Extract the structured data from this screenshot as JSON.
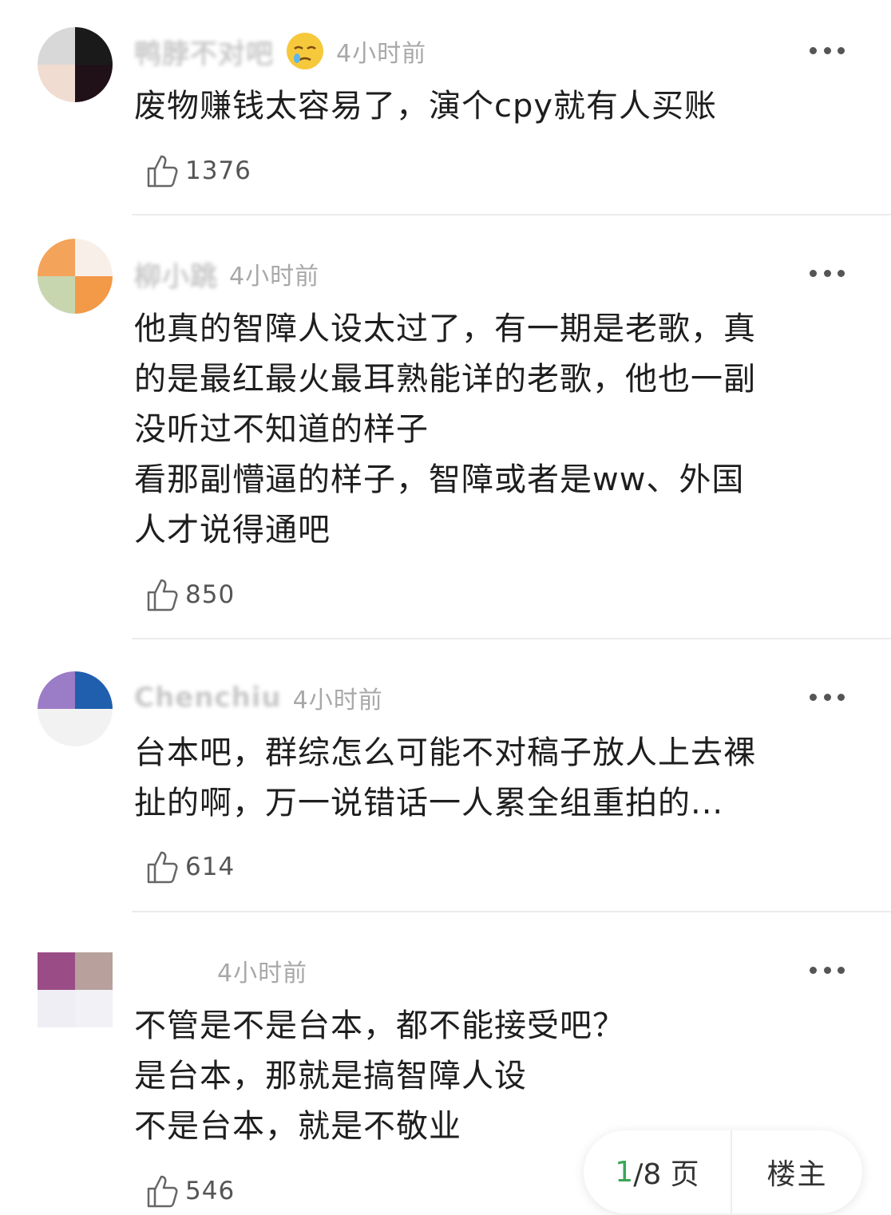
{
  "comments": [
    {
      "username": "鸭脖不对吧",
      "emoji": "sleepy-face-icon",
      "time": "4小时前",
      "text": "废物赚钱太容易了，演个cpy就有人买账",
      "likes": "1376",
      "avatar_colors": [
        "#d8d8d8",
        "#1a1a1a",
        "#f0dcd0",
        "#201018"
      ]
    },
    {
      "username": "柳小跳",
      "time": "4小时前",
      "text": "他真的智障人设太过了，有一期是老歌，真\n的是最红最火最耳熟能详的老歌，他也一副\n没听过不知道的样子\n看那副懵逼的样子，智障或者是ww、外国\n人才说得通吧",
      "likes": "850",
      "avatar_colors": [
        "#f3a35a",
        "#f8f0e8",
        "#c8d6b0",
        "#f29a48"
      ]
    },
    {
      "username": "Chenchiu",
      "time": "4小时前",
      "text": "台本吧，群综怎么可能不对稿子放人上去裸\n扯的啊，万一说错话一人累全组重拍的...",
      "likes": "614",
      "avatar_colors": [
        "#9b7cc6",
        "#1f5fae",
        "#f2f2f2",
        "#f2f2f2"
      ]
    },
    {
      "username": "",
      "time": "4小时前",
      "text": "不管是不是台本，都不能接受吧？\n是台本，那就是搞智障人设\n不是台本，就是不敬业",
      "likes": "546",
      "avatar_colors": [
        "#9a4c86",
        "#b8a09c",
        "#eeeef4",
        "#f2f2f6"
      ]
    }
  ],
  "pager": {
    "current": "1",
    "total": "/8 页",
    "host_label": "楼主"
  }
}
